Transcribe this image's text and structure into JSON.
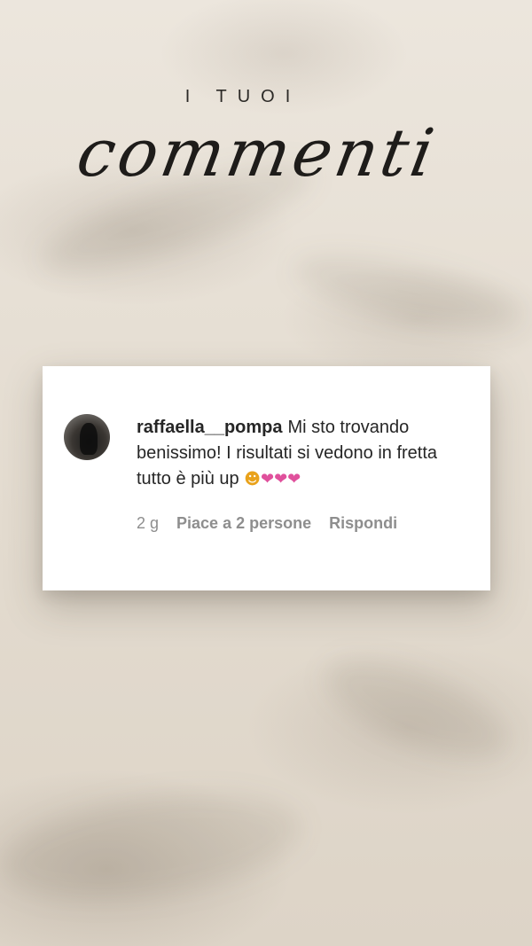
{
  "header": {
    "eyebrow": "I TUOI",
    "title": "commenti"
  },
  "comment": {
    "username": "raffaella__pompa",
    "text": "Mi sto trovando benissimo! I risultati si vedono in fretta tutto è più up",
    "emojis": [
      "heart-eyes-emoji",
      "two-hearts-emoji",
      "two-hearts-emoji",
      "two-hearts-emoji"
    ],
    "time": "2 g",
    "likes": "Piace a 2 persone",
    "reply": "Rispondi"
  },
  "colors": {
    "background": "#e6ded3",
    "card": "#ffffff",
    "text": "#262626",
    "meta": "#8e8e8e"
  }
}
